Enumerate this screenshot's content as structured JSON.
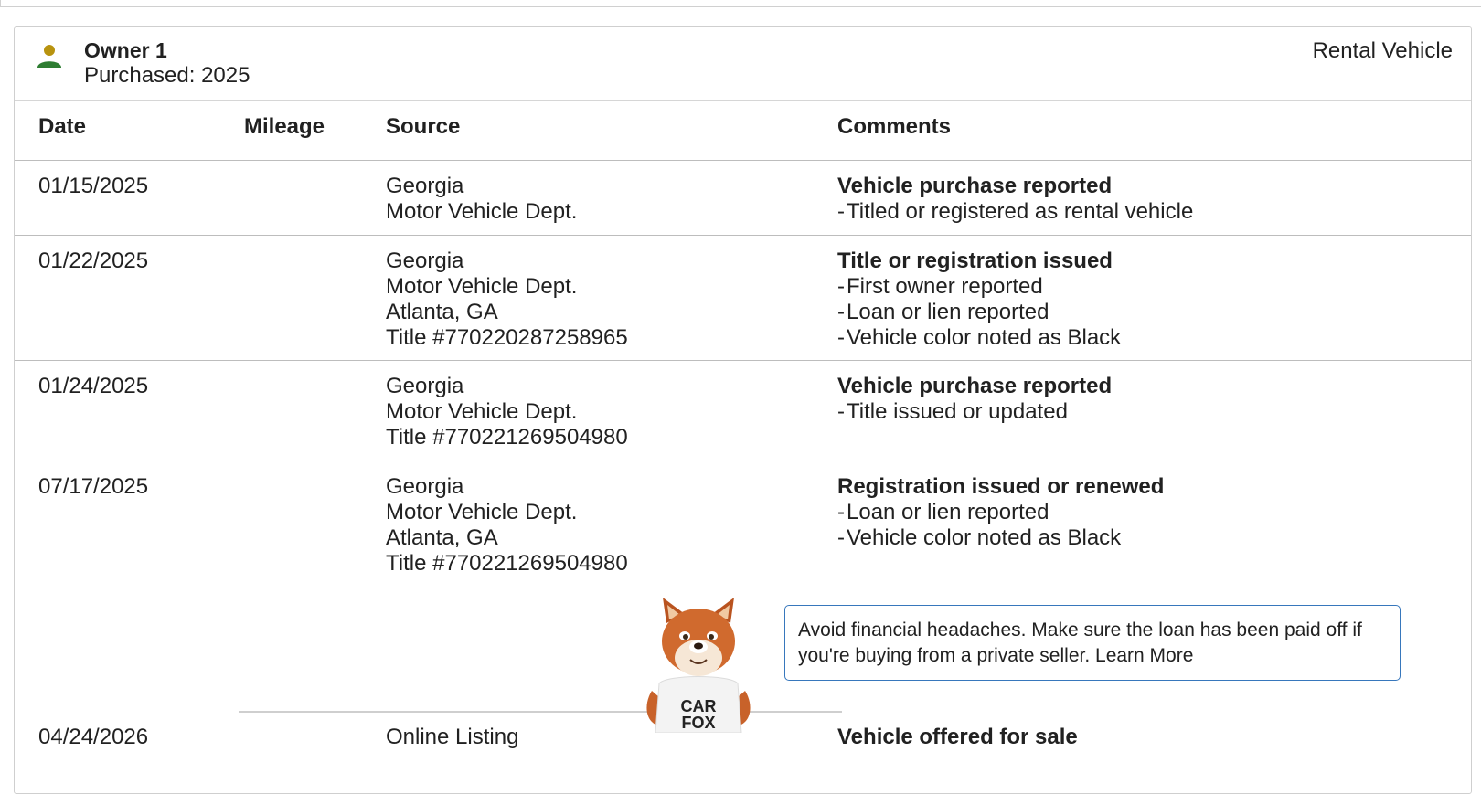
{
  "owner": {
    "title": "Owner 1",
    "purchased": "Purchased: 2025",
    "vehicle_type": "Rental Vehicle",
    "icon": "person-icon",
    "icon_colors": {
      "head": "#b8930f",
      "body": "#2e7d32"
    }
  },
  "columns": {
    "date": "Date",
    "mileage": "Mileage",
    "source": "Source",
    "comments": "Comments"
  },
  "rows": [
    {
      "date": "01/15/2025",
      "source": [
        "Georgia",
        "Motor Vehicle Dept."
      ],
      "title": "Vehicle purchase reported",
      "items": [
        "Titled or registered as rental vehicle"
      ]
    },
    {
      "date": "01/22/2025",
      "source": [
        "Georgia",
        "Motor Vehicle Dept.",
        "Atlanta, GA",
        "Title #770220287258965"
      ],
      "title": "Title or registration issued",
      "items": [
        "First owner reported",
        "Loan or lien reported",
        "Vehicle color noted as Black"
      ]
    },
    {
      "date": "01/24/2025",
      "source": [
        "Georgia",
        "Motor Vehicle Dept.",
        "Title #770221269504980"
      ],
      "title": "Vehicle purchase reported",
      "items": [
        "Title issued or updated"
      ]
    },
    {
      "date": "07/17/2025",
      "source": [
        "Georgia",
        "Motor Vehicle Dept.",
        "Atlanta, GA",
        "Title #770221269504980"
      ],
      "title": "Registration issued or renewed",
      "items": [
        "Loan or lien reported",
        "Vehicle color noted as Black"
      ]
    },
    {
      "date": "04/24/2026",
      "source": [
        "Online Listing"
      ],
      "title": "Vehicle offered for sale",
      "items": []
    }
  ],
  "tip": {
    "text": "Avoid financial headaches. Make sure the loan has been paid off if you're buying from a private seller.",
    "link": "Learn More",
    "border_color": "#3777bc"
  },
  "mascot": {
    "icon": "carfox-mascot-icon",
    "shirt_text_line1": "CAR",
    "shirt_text_line2": "FOX"
  }
}
